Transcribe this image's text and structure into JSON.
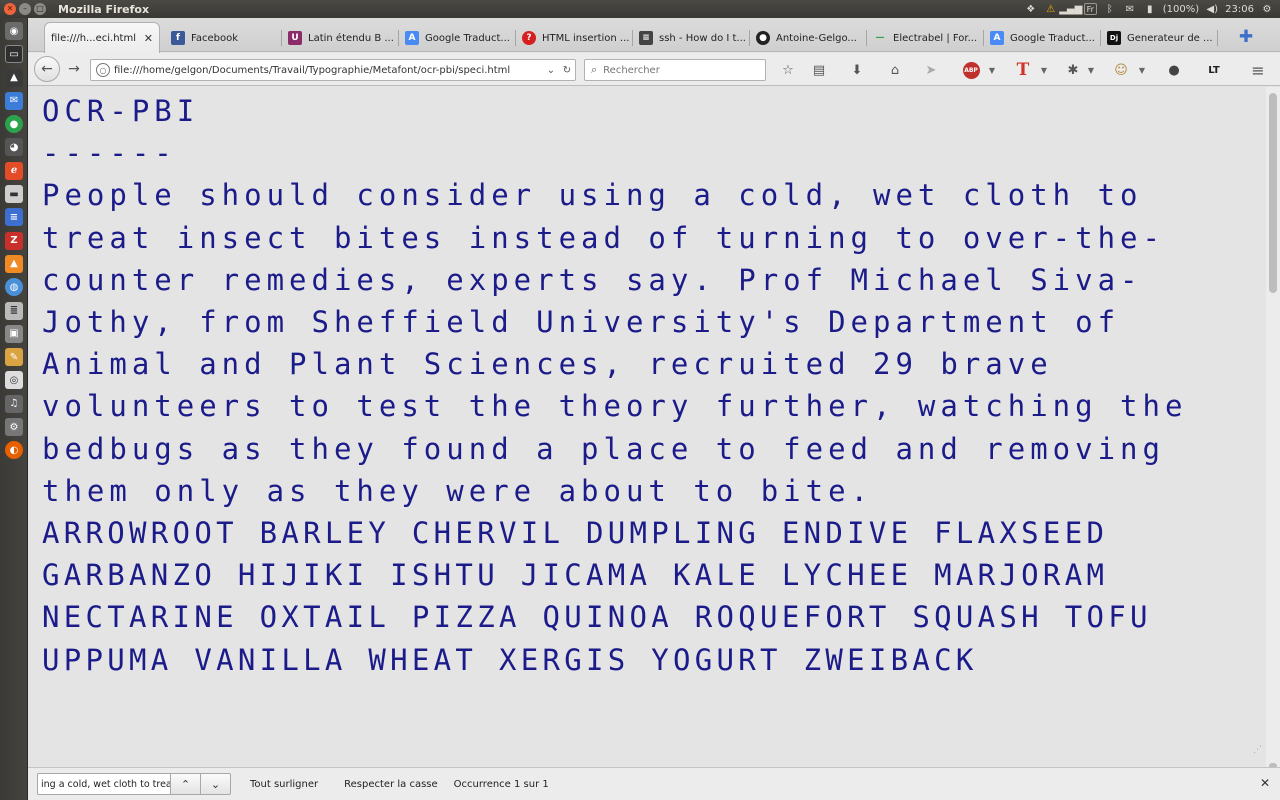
{
  "system": {
    "window_title": "Mozilla Firefox",
    "battery": "(100%)",
    "clock": "23:06",
    "keyboard_layout": "Fr"
  },
  "tabs": [
    {
      "label": "file:///h...eci.html",
      "active": true,
      "icon": "file-icon",
      "close": "✕"
    },
    {
      "label": "Facebook",
      "icon": "facebook-icon"
    },
    {
      "label": "Latin étendu B ...",
      "icon": "unicode-icon"
    },
    {
      "label": "Google Traduct...",
      "icon": "google-translate-icon"
    },
    {
      "label": "HTML insertion ...",
      "icon": "question-icon"
    },
    {
      "label": "ssh - How do I t...",
      "icon": "stackoverflow-icon"
    },
    {
      "label": "Antoine-Gelgo...",
      "icon": "github-icon"
    },
    {
      "label": "Electrabel | For...",
      "icon": "electrabel-icon"
    },
    {
      "label": "Google Traduct...",
      "icon": "google-translate-icon"
    },
    {
      "label": "Generateur de ...",
      "icon": "dj-icon"
    }
  ],
  "navbar": {
    "url": "file:///home/gelgon/Documents/Travail/Typographie/Metafont/ocr-pbi/speci.html",
    "search_placeholder": "Rechercher",
    "abp_label": "ABP",
    "lt_label": "LT"
  },
  "document": {
    "heading": "OCR-PBI",
    "underline": "------",
    "paragraph": "People should consider using a cold, wet cloth to treat insect bites instead of turning to over-the-counter remedies, experts say. Prof Michael Siva-Jothy, from Sheffield University's Department of Animal and Plant Sciences, recruited 29 brave volunteers to test the theory further, watching the bedbugs as they found a place to feed and removing them only as they were about to bite.",
    "word_list": "ARROWROOT BARLEY CHERVIL DUMPLING ENDIVE FLAXSEED GARBANZO HIJIKI ISHTU JICAMA KALE LYCHEE MARJORAM NECTARINE OXTAIL PIZZA QUINOA ROQUEFORT SQUASH TOFU UPPUMA VANILLA WHEAT XERGIS YOGURT ZWEIBACK"
  },
  "findbar": {
    "query": "ing a cold, wet cloth to treat",
    "highlight_all": "Tout surligner",
    "match_case": "Respecter la casse",
    "result": "Occurrence 1 sur 1"
  }
}
